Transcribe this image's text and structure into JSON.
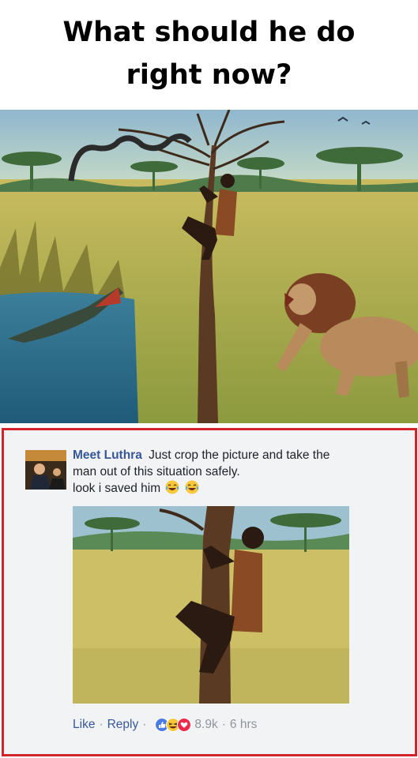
{
  "headline": {
    "line1": "What should he do",
    "line2": "right now?"
  },
  "comment": {
    "author": "Meet Luthra",
    "text_line1": "Just crop the picture and take the",
    "text_line2": "man out of this situation safely.",
    "text_line3": "look i saved him",
    "emoji": "laughing-face-emoji",
    "actions": {
      "like_label": "Like",
      "reply_label": "Reply",
      "separator": "·",
      "reaction_count": "8.9k",
      "time": "6 hrs"
    },
    "reactions": [
      "like-reaction-icon",
      "haha-reaction-icon",
      "love-reaction-icon"
    ]
  },
  "colors": {
    "frame_border": "#d2232a",
    "author_link": "#365899",
    "comment_bg": "#f2f3f5",
    "muted_text": "#90949c"
  }
}
